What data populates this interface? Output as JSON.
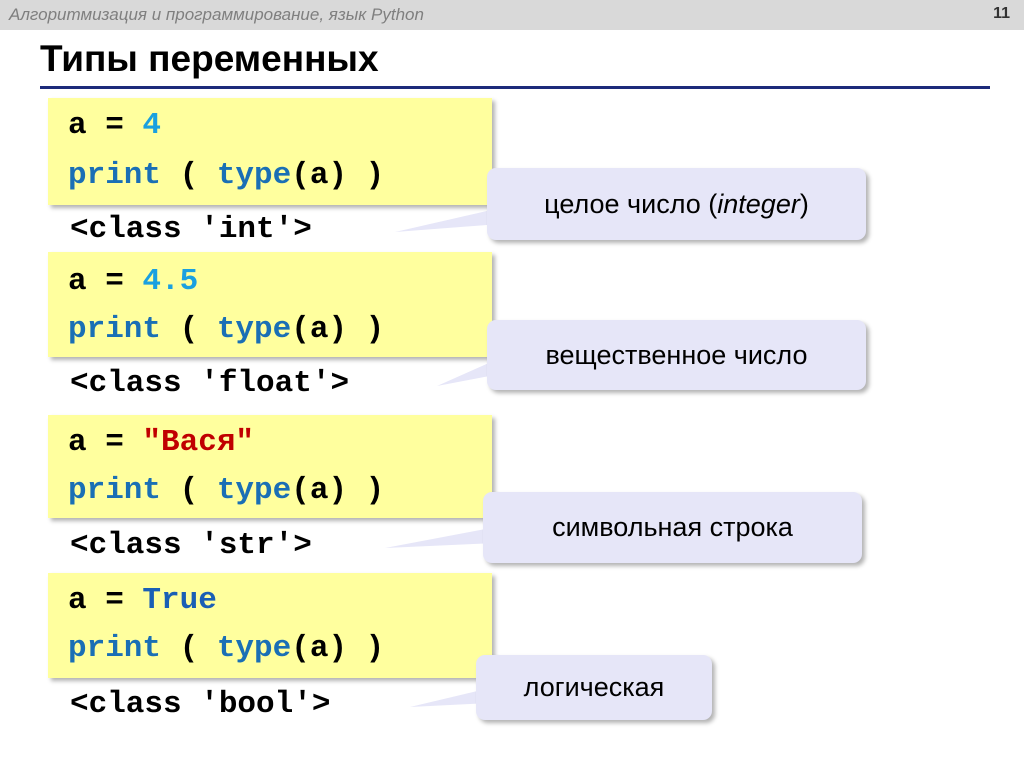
{
  "header": {
    "course": "Алгоритмизация и программирование, язык Python",
    "page_number": "11"
  },
  "title": "Типы переменных",
  "examples": [
    {
      "var": "a",
      "eq": " = ",
      "value": "4",
      "value_kind": "num",
      "print_kw": "print",
      "open": " ( ",
      "type_kw": "type",
      "args": "(a) )",
      "output": "<class 'int'>",
      "callout": "целое число (",
      "callout_italic": "integer",
      "callout_end": ")"
    },
    {
      "var": "a",
      "eq": " = ",
      "value": "4.5",
      "value_kind": "num",
      "print_kw": "print",
      "open": " ( ",
      "type_kw": "type",
      "args": "(a) )",
      "output": "<class 'float'>",
      "callout": "вещественное число"
    },
    {
      "var": "a",
      "eq": " = ",
      "value": "\"Вася\"",
      "value_kind": "str",
      "print_kw": "print",
      "open": " ( ",
      "type_kw": "type",
      "args": "(a) )",
      "output": "<class 'str'>",
      "callout": "символьная строка"
    },
    {
      "var": "a",
      "eq": " = ",
      "value": "True",
      "value_kind": "tr",
      "print_kw": "print",
      "open": " ( ",
      "type_kw": "type",
      "args": "(a) )",
      "output": "<class 'bool'>",
      "callout": "логическая"
    }
  ],
  "colors": {
    "code_bg": "#ffff9e",
    "callout_bg": "#e6e6f8",
    "keyword": "#1a6fb5",
    "number": "#1aa0e0",
    "string": "#c00000",
    "rule": "#1c2a7a"
  }
}
